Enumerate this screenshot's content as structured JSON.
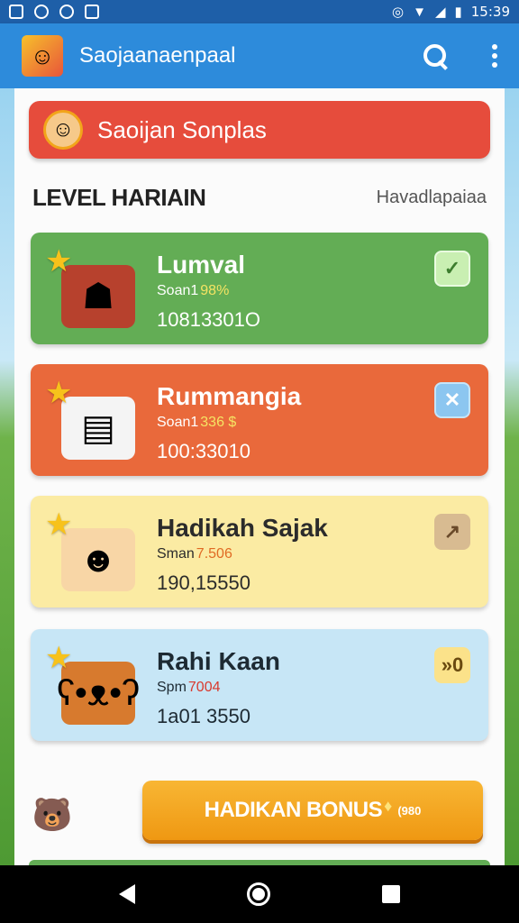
{
  "status_bar": {
    "time": "15:39"
  },
  "app_bar": {
    "title": "Saojaanaenpaal",
    "icons": [
      "search-icon",
      "more-vert-icon"
    ]
  },
  "banner": {
    "title": "Saoijan Sonplas"
  },
  "section": {
    "title": "LEVEL HARIAIN",
    "link": "Havadlapaiaa"
  },
  "cards": [
    {
      "name": "Lumval",
      "sub_prefix": "Soan1",
      "sub_highlight": "98%",
      "number": "10813301O",
      "badge": "✓"
    },
    {
      "name": "Rummangia",
      "sub_prefix": "Soan1",
      "sub_highlight": "336 $",
      "number": "100:33010",
      "badge": "✕"
    },
    {
      "name": "Hadikah Sajak",
      "sub_prefix": "Sman",
      "sub_highlight": "7.506",
      "number": "190,15550",
      "badge": "↗"
    },
    {
      "name": "Rahi Kaan",
      "sub_prefix": "Spm",
      "sub_highlight": "7004",
      "number": "1a01 3550",
      "badge": "»0"
    }
  ],
  "bonus_button": {
    "label": "HADIKAN BONUS",
    "small": "(980"
  },
  "colors": {
    "app_bar": "#2d8bdb",
    "banner": "#e64c3c",
    "card_green": "#63ad55",
    "card_orange": "#e9693b",
    "card_yellow": "#fbeba3",
    "card_blue": "#c7e6f6",
    "bonus": "#f0a21a"
  }
}
